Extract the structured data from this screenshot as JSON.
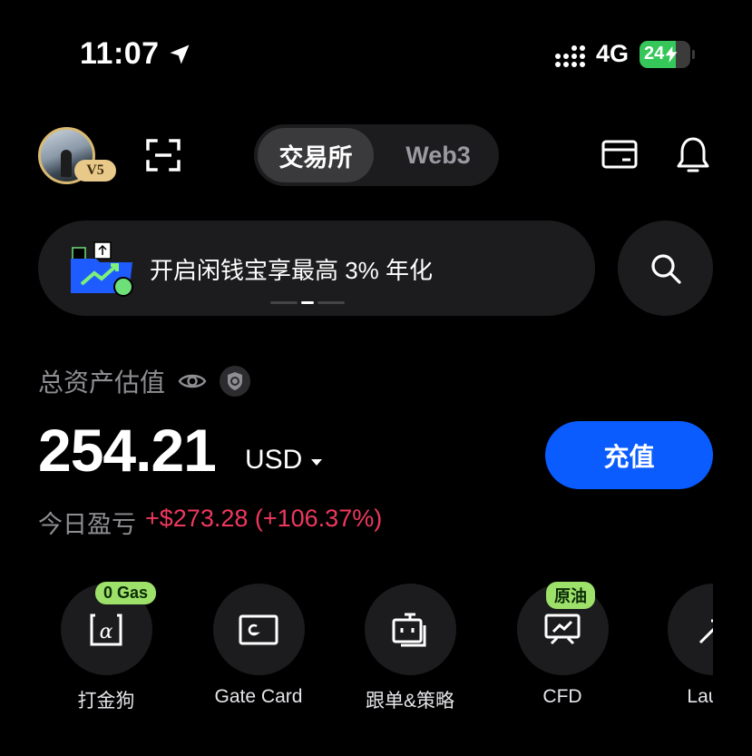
{
  "status_bar": {
    "time": "11:07",
    "network": "4G",
    "battery": "24"
  },
  "header": {
    "vip_level": "V5",
    "tabs": [
      {
        "label": "交易所",
        "active": true
      },
      {
        "label": "Web3",
        "active": false
      }
    ]
  },
  "banner": {
    "text": "开启闲钱宝享最高 3% 年化",
    "page_index": 1,
    "page_count": 3
  },
  "balance": {
    "label": "总资产估值",
    "value": "254.21",
    "currency": "USD",
    "deposit_label": "充值",
    "pnl_label": "今日盈亏",
    "pnl_value": "+$273.28 (+106.37%)"
  },
  "shortcuts": [
    {
      "label": "打金狗",
      "badge": "0 Gas",
      "icon": "alpha-icon"
    },
    {
      "label": "Gate Card",
      "badge": "",
      "icon": "gate-card-icon"
    },
    {
      "label": "跟单&策略",
      "badge": "",
      "icon": "copy-bot-icon"
    },
    {
      "label": "CFD",
      "badge": "原油",
      "icon": "chart-board-icon"
    },
    {
      "label": "Launc",
      "badge": "",
      "icon": "launch-icon"
    }
  ],
  "colors": {
    "accent": "#0a5cff",
    "positive_pnl": "#f0385e",
    "badge": "#9de06a",
    "vip": "#e9c98a"
  }
}
